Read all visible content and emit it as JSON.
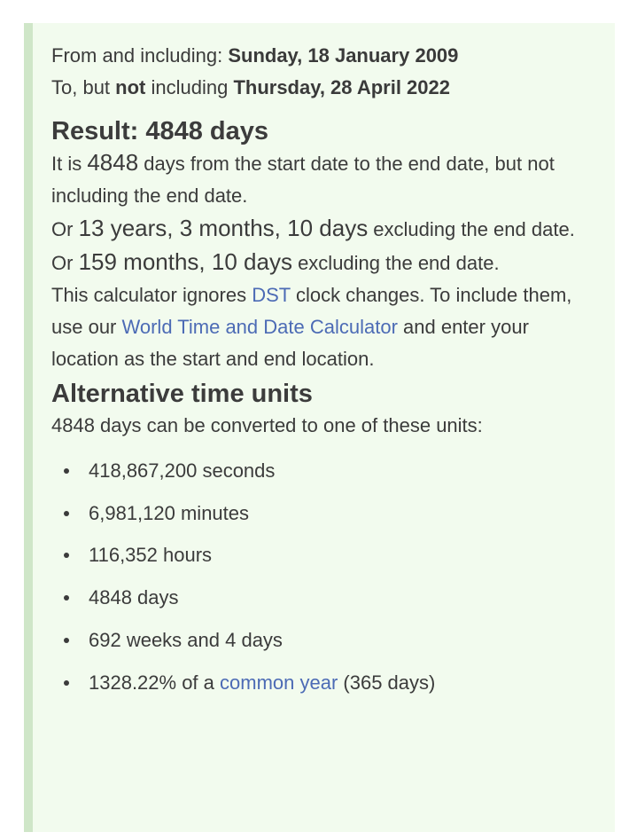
{
  "range": {
    "from_label": "From and including: ",
    "from_date": "Sunday, 18 January 2009",
    "to_label_1": "To, but ",
    "to_not": "not",
    "to_label_2": " including ",
    "to_date": "Thursday, 28 April 2022"
  },
  "result": {
    "title": "Result: 4848 days",
    "itis_prefix": "It is ",
    "itis_value": "4848",
    "itis_suffix": " days from the start date to the end date, but not including the end date.",
    "or1_prefix": "Or ",
    "or1_value": "13 years, 3 months, 10 days",
    "or1_suffix": " excluding the end date.",
    "or2_prefix": "Or ",
    "or2_value": "159 months, 10 days",
    "or2_suffix": " excluding the end date."
  },
  "dst_note": {
    "part1": "This calculator ignores ",
    "dst_link": "DST",
    "part2": " clock changes. To include them, use our ",
    "wtd_link": "World Time and Date Calculator",
    "part3": " and enter your location as the start and end location."
  },
  "alternative": {
    "title": "Alternative time units",
    "intro": "4848 days can be converted to one of these units:",
    "items": [
      "418,867,200 seconds",
      "6,981,120 minutes",
      "116,352 hours",
      "4848 days",
      "692 weeks and 4 days"
    ],
    "last_prefix": "1328.22% of a ",
    "last_link": "common year",
    "last_suffix": " (365 days)"
  },
  "colors": {
    "card_background": "#f2fbee",
    "card_border": "#cfe6c8",
    "link": "#4c6bb5",
    "text": "#3b3b3b"
  }
}
